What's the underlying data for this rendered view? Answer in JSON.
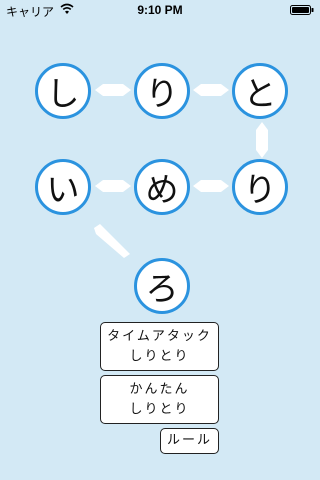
{
  "status_bar": {
    "carrier": "キャリア",
    "time": "9:10 PM"
  },
  "board": {
    "tiles": [
      "し",
      "り",
      "と",
      "り",
      "め",
      "い",
      "ろ"
    ]
  },
  "menu": {
    "time_attack_line1": "タイムアタック",
    "time_attack_line2": "しりとり",
    "easy_line1": "かんたん",
    "easy_line2": "しりとり",
    "rules": "ルール"
  }
}
